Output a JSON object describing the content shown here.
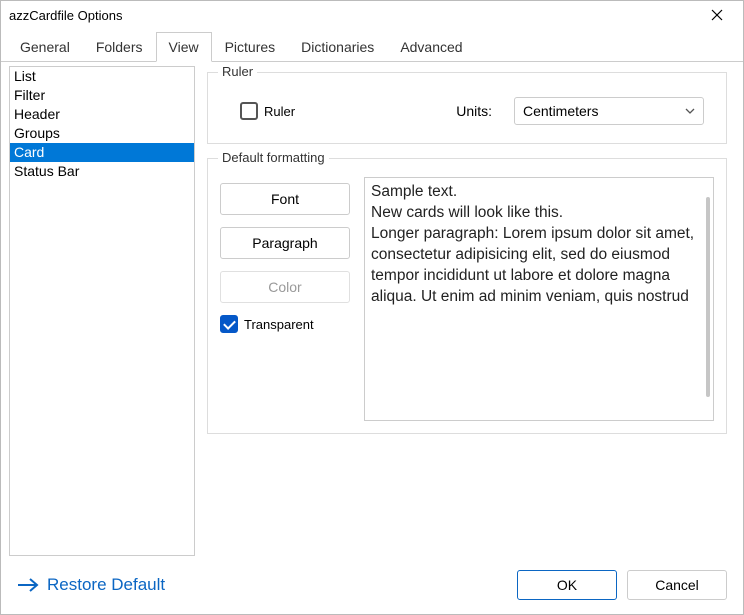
{
  "window": {
    "title": "azzCardfile Options"
  },
  "tabs": {
    "items": [
      "General",
      "Folders",
      "View",
      "Pictures",
      "Dictionaries",
      "Advanced"
    ],
    "active_index": 2
  },
  "sidebar": {
    "items": [
      "List",
      "Filter",
      "Header",
      "Groups",
      "Card",
      "Status Bar"
    ],
    "selected_index": 4
  },
  "ruler_group": {
    "title": "Ruler",
    "checkbox_label": "Ruler",
    "checkbox_checked": false,
    "units_label": "Units:",
    "units_value": "Centimeters"
  },
  "format_group": {
    "title": "Default formatting",
    "font_btn": "Font",
    "paragraph_btn": "Paragraph",
    "color_btn": "Color",
    "transparent_label": "Transparent",
    "transparent_checked": true,
    "sample_text": "Sample text.\nNew cards will look like this.\nLonger paragraph: Lorem ipsum dolor sit amet, consectetur adipisicing elit, sed do eiusmod tempor incididunt ut labore et dolore magna aliqua. Ut enim ad minim veniam, quis nostrud"
  },
  "footer": {
    "restore": "Restore Default",
    "ok": "OK",
    "cancel": "Cancel"
  }
}
